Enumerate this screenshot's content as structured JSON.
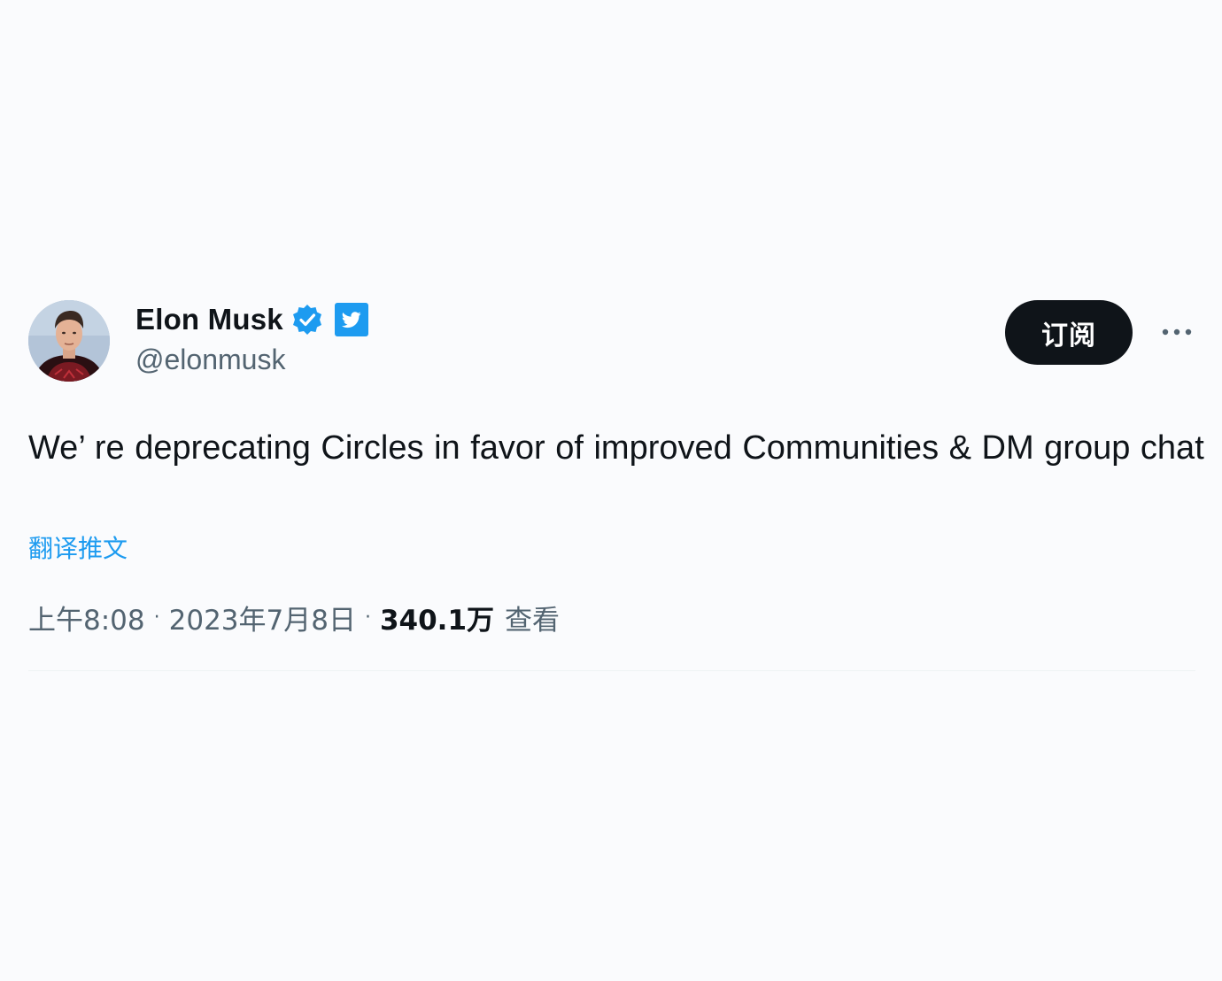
{
  "author": {
    "name": "Elon Musk",
    "handle": "@elonmusk"
  },
  "actions": {
    "subscribe_label": "订阅"
  },
  "tweet": {
    "text": "We’ re deprecating Circles in favor of improved Communities & DM group chat",
    "translate_label": "翻译推文"
  },
  "meta": {
    "time": "上午8:08",
    "separator": "·",
    "date": "2023年7月8日",
    "views_count": "340.1万",
    "views_label": "查看"
  },
  "icons": {
    "verified": "verified-badge-icon",
    "bird": "twitter-bird-icon",
    "more": "more-horizontal-icon"
  },
  "colors": {
    "accent": "#1d9bf0",
    "text": "#0f1419",
    "secondary_text": "#536471",
    "button_bg": "#0f1419"
  }
}
